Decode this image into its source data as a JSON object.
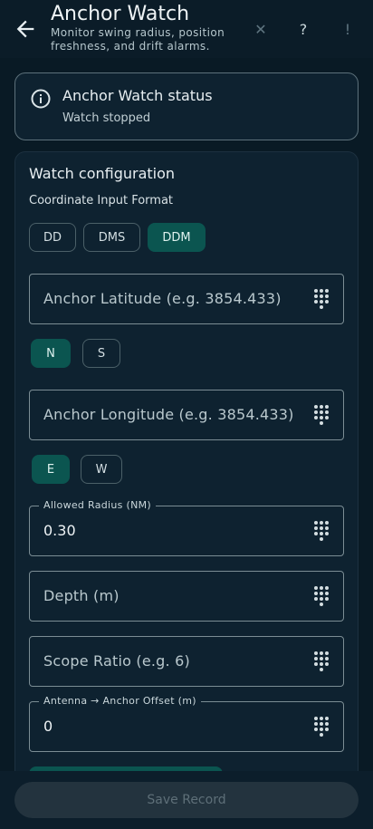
{
  "appbar": {
    "title": "Anchor Watch",
    "subtitle": "Monitor swing radius, position freshness, and drift alarms.",
    "icons": [
      "back-arrow-icon",
      "close-icon",
      "help-icon",
      "alert-icon"
    ],
    "help_glyph": "?",
    "close_glyph": "✕",
    "alert_glyph": "!"
  },
  "status": {
    "title": "Anchor Watch status",
    "state": "Watch stopped",
    "icon": "info-icon"
  },
  "config": {
    "title": "Watch configuration",
    "format_label": "Coordinate Input Format",
    "formats": [
      {
        "label": "DD",
        "selected": false
      },
      {
        "label": "DMS",
        "selected": false
      },
      {
        "label": "DDM",
        "selected": true
      }
    ],
    "latitude": {
      "placeholder": "Anchor Latitude (e.g. 3854.433)"
    },
    "lat_hemi": [
      {
        "label": "N",
        "selected": true
      },
      {
        "label": "S",
        "selected": false
      }
    ],
    "longitude": {
      "placeholder": "Anchor Longitude (e.g. 3854.433)"
    },
    "lon_hemi": [
      {
        "label": "E",
        "selected": true
      },
      {
        "label": "W",
        "selected": false
      }
    ],
    "radius": {
      "label": "Allowed Radius (NM)",
      "value": "0.30"
    },
    "depth": {
      "placeholder": "Depth (m)"
    },
    "scope": {
      "placeholder": "Scope Ratio (e.g. 6)"
    },
    "offset": {
      "label": "Antenna → Anchor Offset (m)",
      "value": "0"
    }
  },
  "footer": {
    "save_label": "Save Record",
    "save_enabled": false
  },
  "colors": {
    "background": "#091a25",
    "accent": "#0b5550",
    "outline": "#7b8d94"
  }
}
